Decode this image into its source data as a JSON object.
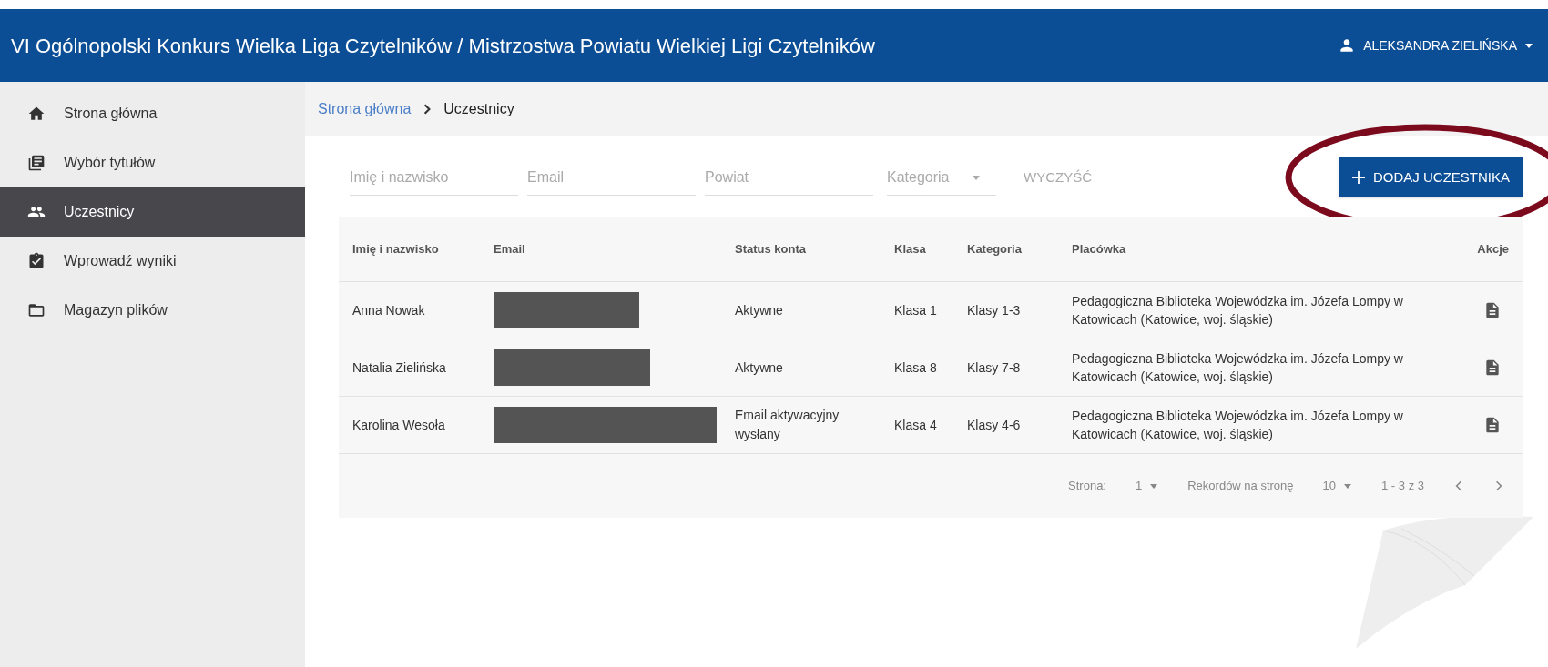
{
  "header": {
    "title": "VI Ogólnopolski Konkurs Wielka Liga Czytelników / Mistrzostwa Powiatu Wielkiej Ligi Czytelników",
    "user": "ALEKSANDRA ZIELIŃSKA"
  },
  "sidebar": {
    "items": [
      {
        "label": "Strona główna",
        "selected": false
      },
      {
        "label": "Wybór tytułów",
        "selected": false
      },
      {
        "label": "Uczestnicy",
        "selected": true
      },
      {
        "label": "Wprowadź wyniki",
        "selected": false
      },
      {
        "label": "Magazyn plików",
        "selected": false
      }
    ]
  },
  "breadcrumb": {
    "link": "Strona główna",
    "current": "Uczestnicy"
  },
  "filters": {
    "fields": [
      {
        "placeholder": "Imię i nazwisko"
      },
      {
        "placeholder": "Email"
      },
      {
        "placeholder": "Powiat"
      }
    ],
    "select": "Kategoria",
    "clear": "WYCZYŚĆ",
    "add": "DODAJ UCZESTNIKA",
    "highlighted": true
  },
  "table": {
    "columns": [
      "Imię i nazwisko",
      "Email",
      "Status konta",
      "Klasa",
      "Kategoria",
      "Placówka",
      "Akcje"
    ],
    "rows": [
      {
        "name": "Anna Nowak",
        "redacted": true,
        "status": "Aktywne",
        "klasa": "Klasa 1",
        "kategoria": "Klasy 1-3",
        "placowka": "Pedagogiczna Biblioteka Wojewódzka im. Józefa Lompy w Katowicach (Katowice, woj. śląskie)"
      },
      {
        "name": "Natalia Zielińska",
        "redacted": true,
        "status": "Aktywne",
        "klasa": "Klasa 8",
        "kategoria": "Klasy 7-8",
        "placowka": "Pedagogiczna Biblioteka Wojewódzka im. Józefa Lompy w Katowicach (Katowice, woj. śląskie)"
      },
      {
        "name": "Karolina Wesoła",
        "redacted": true,
        "status": "Email aktywacyjny wysłany",
        "klasa": "Klasa 4",
        "kategoria": "Klasy 4-6",
        "placowka": "Pedagogiczna Biblioteka Wojewódzka im. Józefa Lompy w Katowicach (Katowice, woj. śląskie)"
      }
    ]
  },
  "pagination": {
    "page_label": "Strona:",
    "page": "1",
    "per_page_label": "Rekordów na stronę",
    "per_page": "10",
    "range": "1 - 3 z 3"
  }
}
